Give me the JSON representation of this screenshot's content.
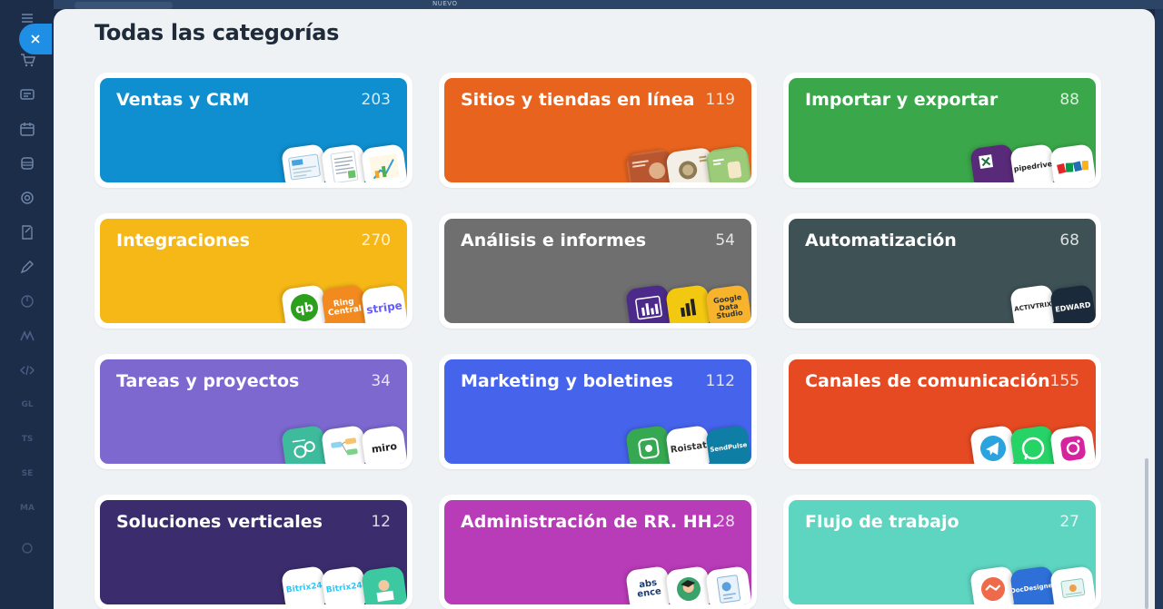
{
  "topbar": {
    "badge": "NUEVO"
  },
  "sidebar": {
    "icons": [
      "menu-icon",
      "cart-icon",
      "contact-card-icon",
      "calendar-icon",
      "storage-icon",
      "target-icon",
      "document-edit-icon",
      "pen-icon",
      "chart-icon",
      "marketplace-icon",
      "code-icon"
    ],
    "text_items": [
      "GL",
      "TS",
      "SE",
      "MA"
    ]
  },
  "page": {
    "title": "Todas las categorías"
  },
  "categories": [
    {
      "name": "Ventas y CRM",
      "count": "203",
      "color": "#0f8fcf",
      "tiles": [
        "form-icon",
        "document-icon",
        "chart-icon"
      ]
    },
    {
      "name": "Sitios y tiendas en línea",
      "count": "119",
      "color": "#e8641e",
      "tiles": [
        "website-preview-icon",
        "website-preview-icon",
        "website-preview-icon"
      ]
    },
    {
      "name": "Importar y exportar",
      "count": "88",
      "color": "#3aa74a",
      "tiles": [
        "excel-bitrix-icon",
        "pipedrive-icon",
        "zoho-icon"
      ]
    },
    {
      "name": "Integraciones",
      "count": "270",
      "color": "#f6b816",
      "tiles": [
        "quickbooks-icon",
        "ringcentral-icon",
        "stripe-icon"
      ],
      "labels": [
        "",
        "Ring Central",
        "stripe"
      ]
    },
    {
      "name": "Análisis e informes",
      "count": "54",
      "color": "#6f6f6f",
      "tiles": [
        "analytics-icon",
        "power-bi-icon",
        "google-data-studio-icon"
      ],
      "labels": [
        "",
        "",
        "Google Data Studio"
      ]
    },
    {
      "name": "Automatización",
      "count": "68",
      "color": "#3e5256",
      "tiles": [
        "activtrix-icon",
        "edward-icon"
      ],
      "labels": [
        "ACTIVTRIX",
        "EDWARD"
      ]
    },
    {
      "name": "Tareas y proyectos",
      "count": "34",
      "color": "#7c68cf",
      "tiles": [
        "project-management-icon",
        "mindmap-icon",
        "miro-icon"
      ],
      "labels": [
        "",
        "",
        "miro"
      ]
    },
    {
      "name": "Marketing y boletines",
      "count": "112",
      "color": "#4663ec",
      "tiles": [
        "phone-icon",
        "roistat-icon",
        "sendpulse-icon"
      ],
      "labels": [
        "",
        "Roistat",
        "SendPulse"
      ]
    },
    {
      "name": "Canales de comunicación",
      "count": "155",
      "color": "#e64a22",
      "tiles": [
        "telegram-icon",
        "whatsapp-icon",
        "instagram-icon"
      ]
    },
    {
      "name": "Soluciones verticales",
      "count": "12",
      "color": "#3b2d6d",
      "tiles": [
        "bitrix24-icon",
        "bitrix24-icon",
        "education-icon"
      ],
      "labels": [
        "Bitrix24",
        "Bitrix24",
        ""
      ]
    },
    {
      "name": "Administración de RR. HH.",
      "count": "28",
      "color": "#b83bb8",
      "tiles": [
        "absence-icon",
        "graduate-icon",
        "report-icon"
      ],
      "labels": [
        "abs ence",
        "",
        ""
      ]
    },
    {
      "name": "Flujo de trabajo",
      "count": "27",
      "color": "#5ed5c0",
      "tiles": [
        "handshake-icon",
        "docdesigner-icon",
        "certificate-icon"
      ],
      "labels": [
        "",
        "DocDesigner",
        ""
      ]
    }
  ]
}
